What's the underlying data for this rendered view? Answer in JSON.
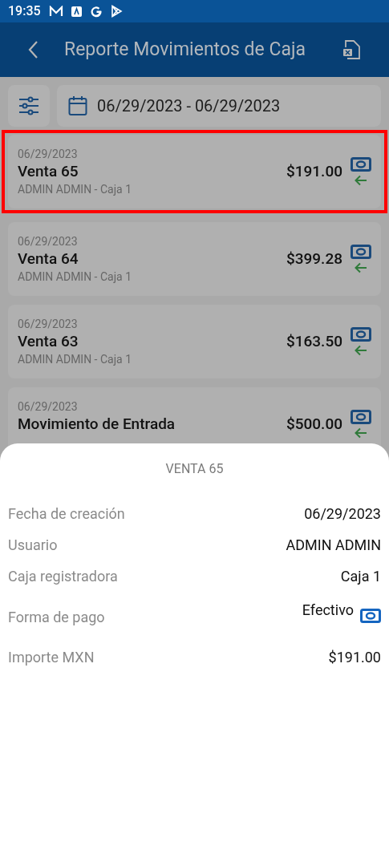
{
  "status_bar": {
    "time": "19:35"
  },
  "header": {
    "title": "Reporte Movimientos de Caja"
  },
  "date_range": {
    "value": "06/29/2023 - 06/29/2023"
  },
  "movements": [
    {
      "date": "06/29/2023",
      "title": "Venta 65",
      "subtitle": "ADMIN ADMIN - Caja 1",
      "amount": "$191.00",
      "selected": true
    },
    {
      "date": "06/29/2023",
      "title": "Venta 64",
      "subtitle": "ADMIN ADMIN - Caja 1",
      "amount": "$399.28",
      "selected": false
    },
    {
      "date": "06/29/2023",
      "title": "Venta 63",
      "subtitle": "ADMIN ADMIN - Caja 1",
      "amount": "$163.50",
      "selected": false
    },
    {
      "date": "06/29/2023",
      "title": "Movimiento de Entrada",
      "amount": "$500.00",
      "selected": false
    }
  ],
  "detail_sheet": {
    "title": "VENTA 65",
    "rows": [
      {
        "kind": "text",
        "label": "Fecha de creación",
        "value": "06/29/2023"
      },
      {
        "kind": "text",
        "label": "Usuario",
        "value": "ADMIN ADMIN"
      },
      {
        "kind": "text",
        "label": "Caja registradora",
        "value": "Caja 1"
      },
      {
        "kind": "payment",
        "label": "Forma de pago",
        "value": "Efectivo"
      },
      {
        "kind": "text",
        "label": "Importe MXN",
        "value": "$191.00"
      }
    ]
  }
}
